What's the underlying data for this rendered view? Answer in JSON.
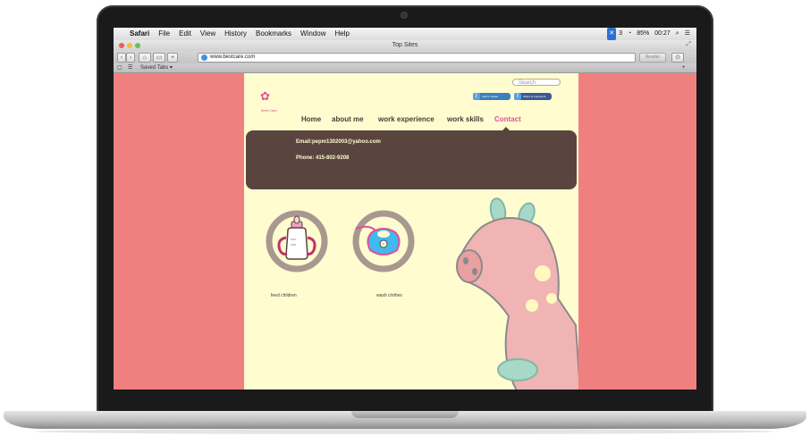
{
  "menubar": {
    "apple": "",
    "app": "Safari",
    "items": [
      "File",
      "Edit",
      "View",
      "History",
      "Bookmarks",
      "Window",
      "Help"
    ],
    "status_count": "3",
    "battery": "85%",
    "clock": "00:27"
  },
  "window": {
    "title": "Top Sites"
  },
  "toolbar": {
    "url": "www.bestcare.com",
    "reader": "Reader"
  },
  "bookmarks_bar": {
    "saved_tabs": "Saved Tabs ▾"
  },
  "site": {
    "search_placeholder": "Search",
    "social": [
      {
        "icon": "t",
        "label": "Add to Twitter",
        "color": "#3a7fbf"
      },
      {
        "icon": "f",
        "label": "Share to Facebook",
        "color": "#3b5998"
      }
    ],
    "logo_text": "Best Care",
    "nav": [
      "Home",
      "about me",
      "work experience",
      "work skills",
      "Contact"
    ],
    "active_nav": "Contact",
    "contact": {
      "email": "Email:pepm1302003@yahoo.com",
      "phone": "Phone: 415-802-9208"
    },
    "services": [
      {
        "label": "feed children",
        "icon": "baby-bottle-icon"
      },
      {
        "label": "wash clothes",
        "icon": "bib-icon"
      }
    ],
    "colors": {
      "page_bg": "#fffcd0",
      "side_bg": "#f08080",
      "contact_bg": "#5a4440",
      "accent": "#e0509a",
      "circle_ring": "#a89890"
    }
  }
}
